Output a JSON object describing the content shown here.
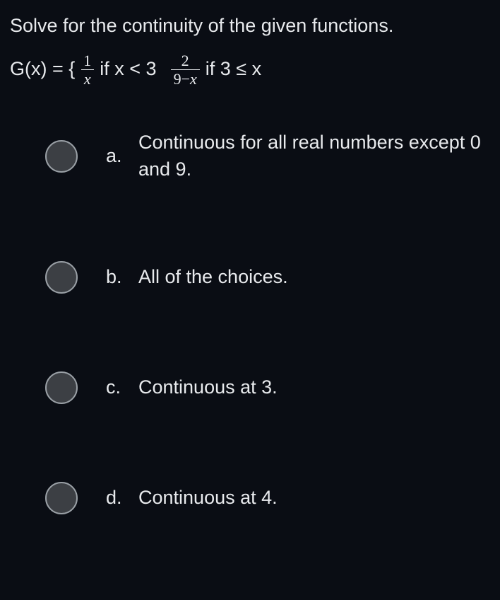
{
  "question": {
    "prompt": "Solve for the continuity of the given functions.",
    "formula": {
      "lhs": "G(x) = {",
      "frac1_num": "1",
      "frac1_den": "x",
      "cond1": "if x < 3",
      "frac2_num": "2",
      "frac2_den": "9−x",
      "cond2": "if 3 ≤ x"
    }
  },
  "options": [
    {
      "letter": "a.",
      "text": "Continuous for all real numbers except 0 and 9."
    },
    {
      "letter": "b.",
      "text": "All of the choices."
    },
    {
      "letter": "c.",
      "text": "Continuous at 3."
    },
    {
      "letter": "d.",
      "text": "Continuous at 4."
    }
  ]
}
